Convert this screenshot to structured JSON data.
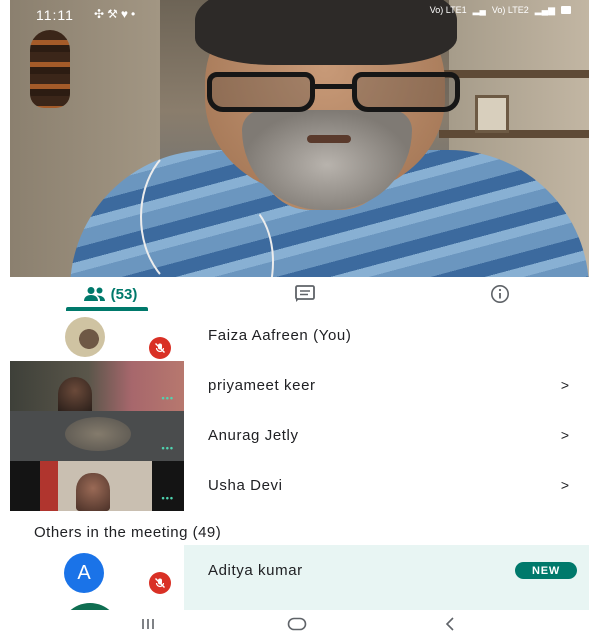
{
  "status_bar": {
    "time": "11:11",
    "network_1": "Vo) LTE1",
    "network_2": "Vo) LTE2"
  },
  "video": {
    "icon": "participant-video-feed"
  },
  "tabs": {
    "people_count": "(53)",
    "chat_icon": "chat-icon",
    "info_icon": "info-icon"
  },
  "participants": [
    {
      "name": "Faiza Aafreen (You)",
      "muted": true
    },
    {
      "name": "priyameet keer",
      "chevron": ">"
    },
    {
      "name": "Anurag Jetly",
      "chevron": ">"
    },
    {
      "name": "Usha Devi",
      "chevron": ">"
    }
  ],
  "others": {
    "section_title": "Others in the meeting (49)",
    "items": [
      {
        "initial": "A",
        "name": "Aditya kumar",
        "badge": "NEW",
        "muted": true
      }
    ]
  },
  "colors": {
    "accent": "#00796b",
    "muted_red": "#d93025",
    "avatar_blue": "#1a73e8",
    "highlight_row": "#e8f5f3"
  }
}
